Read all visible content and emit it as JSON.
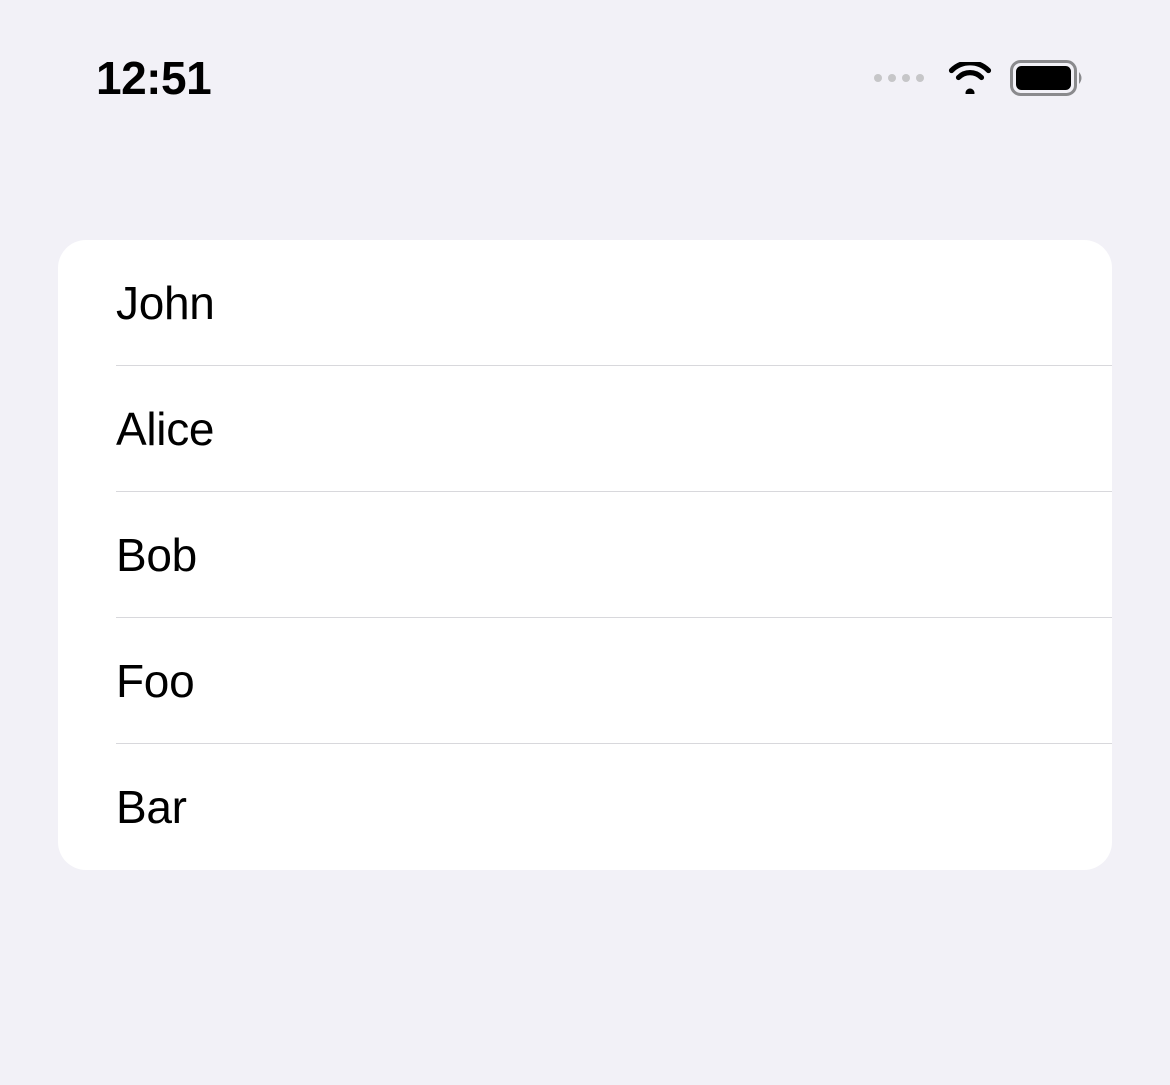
{
  "status": {
    "time": "12:51"
  },
  "list": {
    "items": [
      {
        "label": "John"
      },
      {
        "label": "Alice"
      },
      {
        "label": "Bob"
      },
      {
        "label": "Foo"
      },
      {
        "label": "Bar"
      }
    ]
  }
}
